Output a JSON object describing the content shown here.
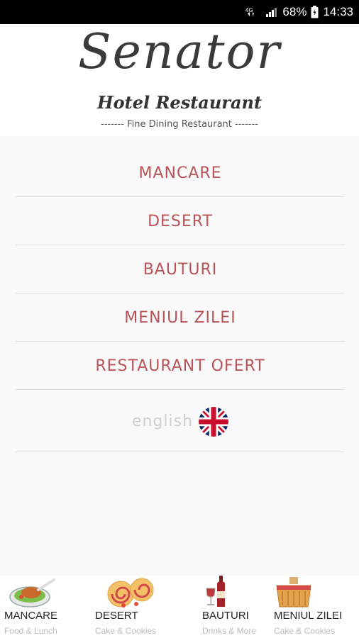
{
  "status_bar": {
    "network": "4G",
    "battery": "68%",
    "time": "14:33"
  },
  "header": {
    "brand": "Senator",
    "subtitle": "Hotel Restaurant",
    "tagline": "------- Fine Dining Restaurant -------"
  },
  "menu": {
    "items": [
      {
        "label": "MANCARE"
      },
      {
        "label": "DESERT"
      },
      {
        "label": "BAUTURI"
      },
      {
        "label": "MENIUL ZILEI"
      },
      {
        "label": "RESTAURANT OFERT"
      }
    ],
    "language": {
      "label": "english",
      "icon": "uk-flag-icon"
    }
  },
  "bottom_nav": {
    "items": [
      {
        "label": "MANCARE",
        "sub": "Food & Lunch",
        "icon": "food-plate-icon"
      },
      {
        "label": "DESERT",
        "sub": "Cake & Cookies",
        "icon": "cake-roll-icon"
      },
      {
        "label": "BAUTURI",
        "sub": "Drinks & More",
        "icon": "wine-icon"
      },
      {
        "label": "MENIUL ZILEI",
        "sub": "Cake & Cookies",
        "icon": "basket-icon"
      }
    ]
  },
  "colors": {
    "accent": "#b85457",
    "muted": "#cfcfcf",
    "divider": "#e2e2e2"
  }
}
